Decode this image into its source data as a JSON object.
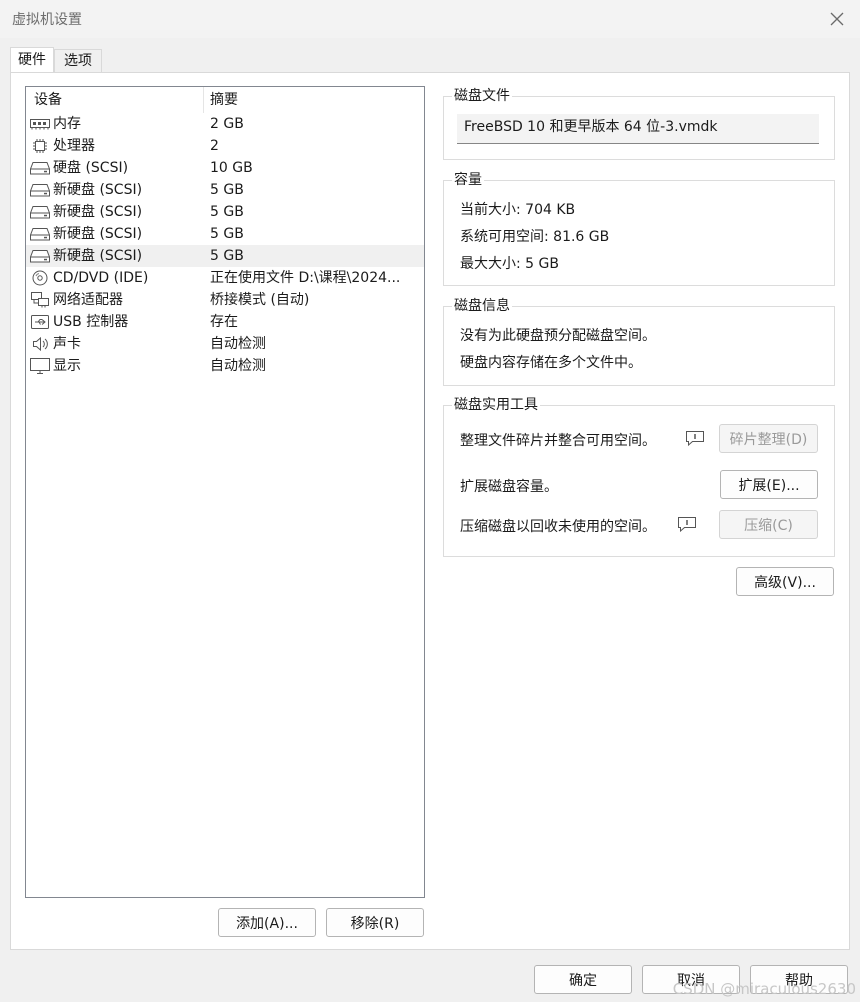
{
  "window": {
    "title": "虚拟机设置"
  },
  "tabs": [
    {
      "label": "硬件"
    },
    {
      "label": "选项"
    }
  ],
  "device_list": {
    "headers": {
      "device": "设备",
      "summary": "摘要"
    },
    "rows": [
      {
        "icon": "memory-icon",
        "name": "内存",
        "summary": "2 GB"
      },
      {
        "icon": "cpu-icon",
        "name": "处理器",
        "summary": "2"
      },
      {
        "icon": "disk-icon",
        "name": "硬盘 (SCSI)",
        "summary": "10 GB"
      },
      {
        "icon": "disk-icon",
        "name": "新硬盘 (SCSI)",
        "summary": "5 GB"
      },
      {
        "icon": "disk-icon",
        "name": "新硬盘 (SCSI)",
        "summary": "5 GB"
      },
      {
        "icon": "disk-icon",
        "name": "新硬盘 (SCSI)",
        "summary": "5 GB"
      },
      {
        "icon": "disk-icon",
        "name": "新硬盘 (SCSI)",
        "summary": "5 GB",
        "selected": true
      },
      {
        "icon": "cd-icon",
        "name": "CD/DVD (IDE)",
        "summary": "正在使用文件 D:\\课程\\2024..."
      },
      {
        "icon": "network-icon",
        "name": "网络适配器",
        "summary": "桥接模式 (自动)"
      },
      {
        "icon": "usb-icon",
        "name": "USB 控制器",
        "summary": "存在"
      },
      {
        "icon": "speaker-icon",
        "name": "声卡",
        "summary": "自动检测"
      },
      {
        "icon": "monitor-icon",
        "name": "显示",
        "summary": "自动检测"
      }
    ]
  },
  "list_buttons": {
    "add": "添加(A)...",
    "remove": "移除(R)"
  },
  "disk_file": {
    "title": "磁盘文件",
    "value": "FreeBSD 10 和更早版本 64 位-3.vmdk"
  },
  "capacity": {
    "title": "容量",
    "current": "当前大小: 704 KB",
    "available": "系统可用空间: 81.6 GB",
    "max": "最大大小: 5 GB"
  },
  "disk_info": {
    "title": "磁盘信息",
    "line1": "没有为此硬盘预分配磁盘空间。",
    "line2": "硬盘内容存储在多个文件中。"
  },
  "disk_tools": {
    "title": "磁盘实用工具",
    "defrag_text": "整理文件碎片并整合可用空间。",
    "defrag_button": "碎片整理(D)",
    "expand_text": "扩展磁盘容量。",
    "expand_button": "扩展(E)...",
    "compact_text": "压缩磁盘以回收未使用的空间。",
    "compact_button": "压缩(C)"
  },
  "advanced_button": "高级(V)...",
  "footer": {
    "ok": "确定",
    "cancel": "取消",
    "help": "帮助"
  },
  "watermark": "CSDN @miraculous2630"
}
